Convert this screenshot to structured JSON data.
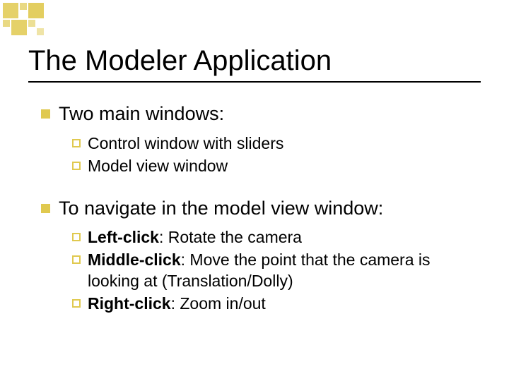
{
  "title": "The Modeler Application",
  "sections": [
    {
      "heading": "Two main windows:",
      "items": [
        {
          "bold": "",
          "rest": "Control window with sliders"
        },
        {
          "bold": "",
          "rest": "Model view window"
        }
      ]
    },
    {
      "heading": "To navigate in the model view window:",
      "items": [
        {
          "bold": "Left-click",
          "rest": ": Rotate the camera"
        },
        {
          "bold": "Middle-click",
          "rest": ": Move the point that the camera is looking at (Translation/Dolly)"
        },
        {
          "bold": "Right-click",
          "rest": ": Zoom in/out"
        }
      ]
    }
  ]
}
